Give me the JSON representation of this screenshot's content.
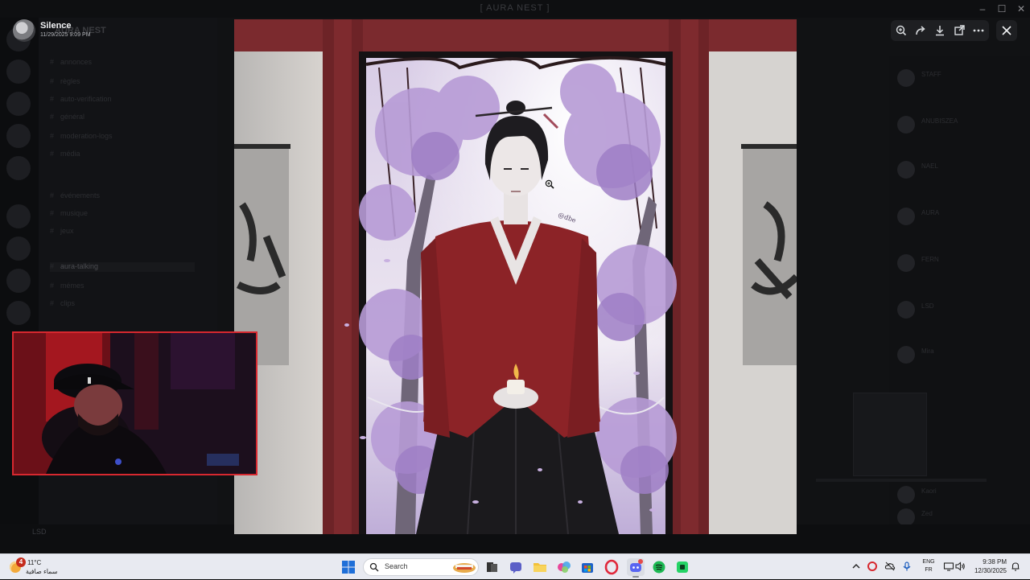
{
  "background_app": {
    "window_title": "[ AURA NEST ]",
    "server_name": "AURA NEST",
    "channels": [
      "annonces",
      "règles",
      "auto-verification",
      "général",
      "moderation-logs",
      "média",
      "événements",
      "musique",
      "jeux",
      "aura-talking",
      "mémes",
      "clips"
    ],
    "active_channel": "aura-talking",
    "user_label": "LSD",
    "members": [
      "STAFF",
      "ANUBISZEA",
      "NAEL",
      "AURA",
      "FERN",
      "LSD",
      "Mira",
      "Kaori",
      "Zed"
    ]
  },
  "viewer": {
    "username": "Silence",
    "timestamp": "11/29/2025 9:09 PM",
    "toolbar": [
      {
        "name": "zoom-in-button",
        "icon": "zoom-in-icon"
      },
      {
        "name": "forward-button",
        "icon": "forward-icon"
      },
      {
        "name": "download-button",
        "icon": "download-icon"
      },
      {
        "name": "open-in-browser-button",
        "icon": "open-external-icon"
      },
      {
        "name": "more-options-button",
        "icon": "more-icon"
      }
    ],
    "close_icon": "close-icon",
    "image_signature": "@dbe"
  },
  "taskbar": {
    "weather": {
      "badge": "4",
      "temperature": "11°C",
      "description": "سماء صافية"
    },
    "search_placeholder": "Search",
    "apps": [
      {
        "name": "task-view",
        "icon": "task-view-icon"
      },
      {
        "name": "copilot",
        "icon": "copilot-icon"
      },
      {
        "name": "file-explorer",
        "icon": "folder-icon"
      },
      {
        "name": "teams",
        "icon": "teams-icon"
      },
      {
        "name": "microsoft-store",
        "icon": "store-icon"
      },
      {
        "name": "opera-gx",
        "icon": "opera-icon"
      },
      {
        "name": "discord",
        "icon": "discord-icon"
      },
      {
        "name": "spotify",
        "icon": "spotify-icon"
      },
      {
        "name": "whatsapp",
        "icon": "whatsapp-icon"
      }
    ],
    "tray": {
      "language_top": "ENG",
      "language_bottom": "FR",
      "time": "9:38 PM",
      "date": "12/30/2025"
    }
  },
  "colors": {
    "taskbar_bg": "#e8eaf1",
    "webcam_border": "#d7282f",
    "kimono": "#8c2327",
    "petals": "#b79bd6"
  }
}
